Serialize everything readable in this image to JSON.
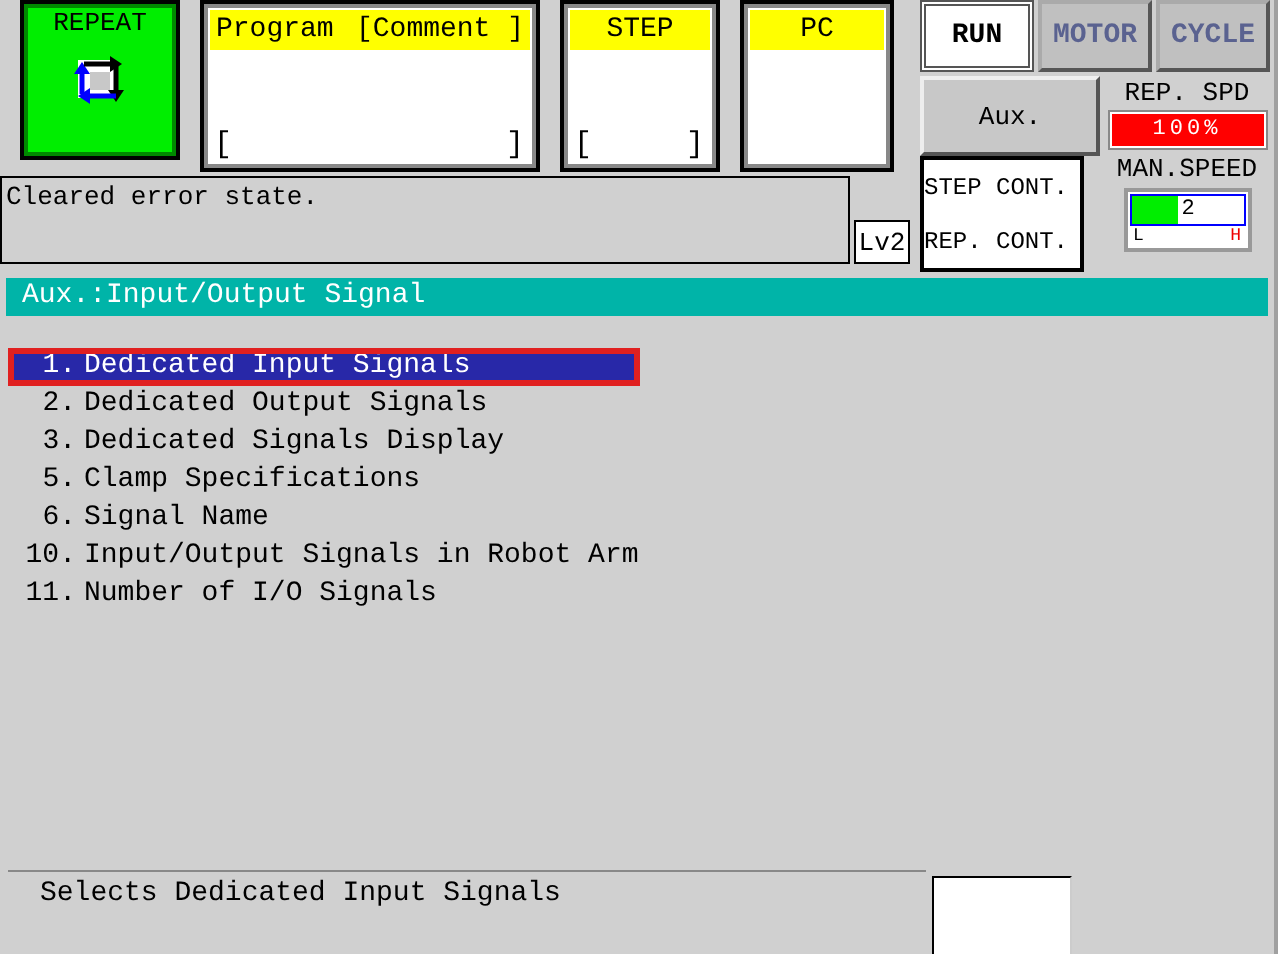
{
  "play_mode": {
    "label": "REPEAT"
  },
  "program": {
    "label": "Program",
    "comment_label": "[Comment ]",
    "open_bracket": "[",
    "close_bracket": "]"
  },
  "step": {
    "label": "STEP",
    "open_bracket": "[",
    "close_bracket": "]"
  },
  "pc": {
    "label": "PC"
  },
  "status_buttons": [
    {
      "label": "RUN",
      "active": true
    },
    {
      "label": "MOTOR",
      "active": false
    },
    {
      "label": "CYCLE",
      "active": false
    }
  ],
  "message": "Cleared error state.",
  "level_badge": "Lv2",
  "aux_button": "Aux.",
  "cont_box": {
    "line_1": "STEP CONT.",
    "line_2": "REP. CONT."
  },
  "rep_speed": {
    "label": "REP. SPD",
    "reading": "100%",
    "level": 1
  },
  "man_speed": {
    "label": "MAN.SPEED",
    "level": 0.42,
    "reading": "2",
    "low": "L",
    "high": "H"
  },
  "header": "Aux.:Input/Output Signal",
  "menu_items": [
    {
      "number": "1.",
      "label": "Dedicated Input Signals",
      "selected": true
    },
    {
      "number": "2.",
      "label": "Dedicated Output Signals",
      "selected": false
    },
    {
      "number": "3.",
      "label": "Dedicated Signals Display",
      "selected": false
    },
    {
      "number": "5.",
      "label": "Clamp Specifications",
      "selected": false
    },
    {
      "number": "6.",
      "label": "Signal Name",
      "selected": false
    },
    {
      "number": "10.",
      "label": "Input/Output Signals in Robot Arm",
      "selected": false
    },
    {
      "number": "11.",
      "label": "Number of I/O Signals",
      "selected": false
    }
  ],
  "help_text": "Selects Dedicated Input Signals"
}
